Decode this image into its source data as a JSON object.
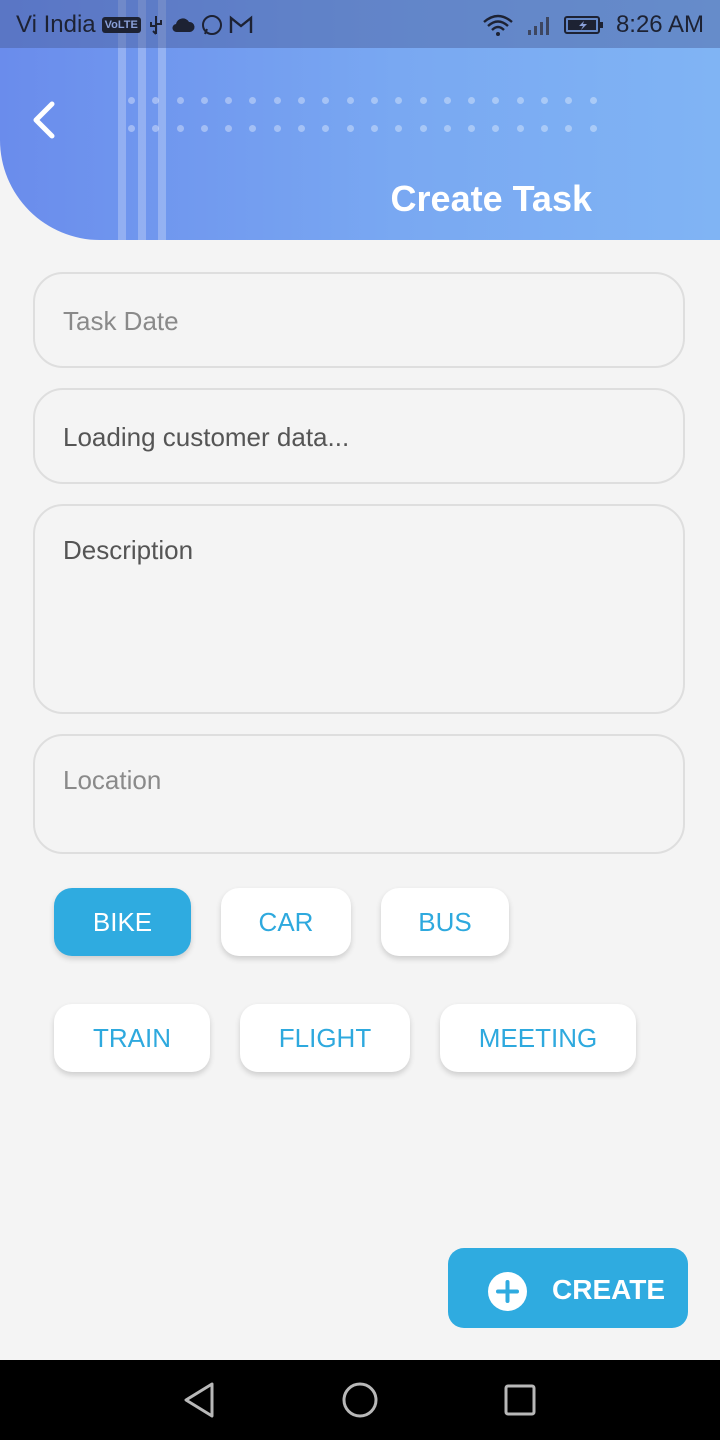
{
  "status_bar": {
    "carrier": "Vi India",
    "volte": "VoLTE",
    "time": "8:26 AM"
  },
  "header": {
    "title": "Create Task",
    "back_icon": "chevron-left-icon"
  },
  "form": {
    "task_date_placeholder": "Task Date",
    "customer_value": "Loading customer data...",
    "description_placeholder": "Description",
    "location_placeholder": "Location"
  },
  "modes": [
    {
      "label": "BIKE",
      "selected": true
    },
    {
      "label": "CAR",
      "selected": false
    },
    {
      "label": "BUS",
      "selected": false
    },
    {
      "label": "TRAIN",
      "selected": false
    },
    {
      "label": "FLIGHT",
      "selected": false
    },
    {
      "label": "MEETING",
      "selected": false
    }
  ],
  "create_button": {
    "label": "CREATE",
    "icon": "plus-circle-icon"
  },
  "nav": {
    "back_icon": "nav-back-icon",
    "home_icon": "nav-home-icon",
    "recents_icon": "nav-recents-icon"
  },
  "colors": {
    "accent": "#2fabe0",
    "header_gradient_start": "#6a8cec",
    "header_gradient_end": "#80b4f4"
  }
}
